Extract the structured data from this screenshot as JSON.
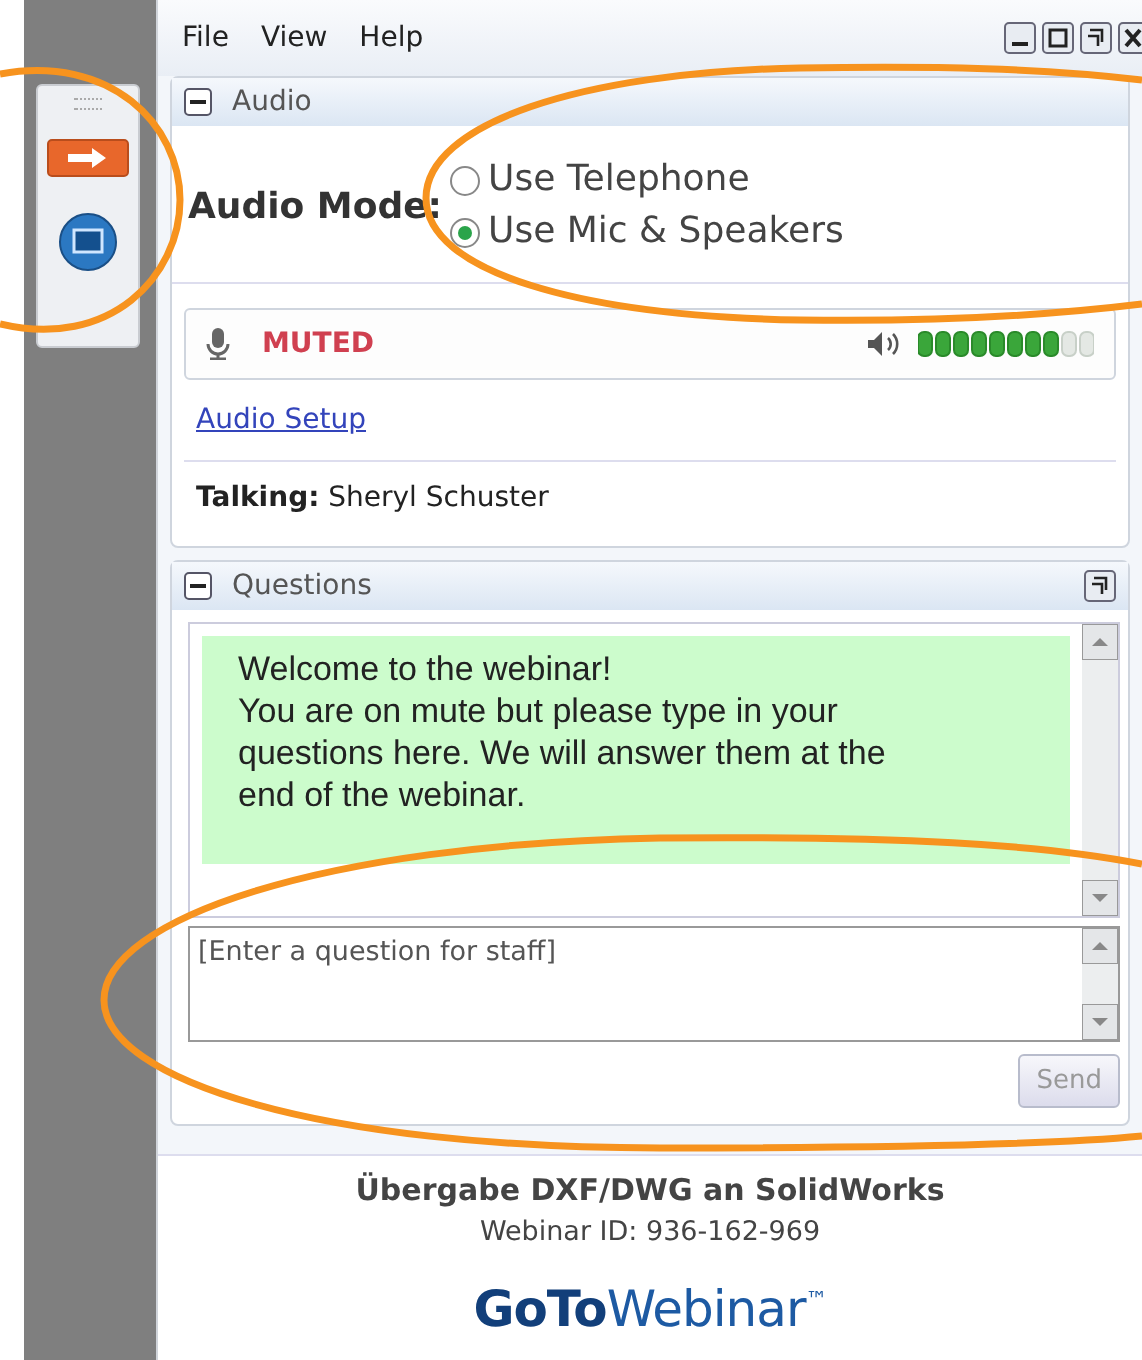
{
  "menu": [
    "File",
    "View",
    "Help"
  ],
  "audio": {
    "title": "Audio",
    "mode_label": "Audio Mode:",
    "options": [
      {
        "label": "Use Telephone",
        "selected": false
      },
      {
        "label": "Use Mic & Speakers",
        "selected": true
      }
    ],
    "status": "MUTED",
    "speaker_meter": {
      "level": 0.8
    },
    "setup_link": "Audio Setup",
    "talking_label": "Talking:",
    "talking_name": "Sheryl Schuster"
  },
  "questions": {
    "title": "Questions",
    "messages": [
      "Welcome to the webinar!\nYou are on mute but please type in your questions here. We will answer them at the end of the webinar."
    ],
    "placeholder": "[Enter a question for staff]",
    "send": "Send",
    "send_disabled": true
  },
  "footer": {
    "title": "Übergabe DXF/DWG an SolidWorks",
    "webinar_id": "Webinar ID: 936-162-969",
    "logo_bold": "GoTo",
    "logo_light": "Webinar",
    "logo_mark": "™"
  }
}
